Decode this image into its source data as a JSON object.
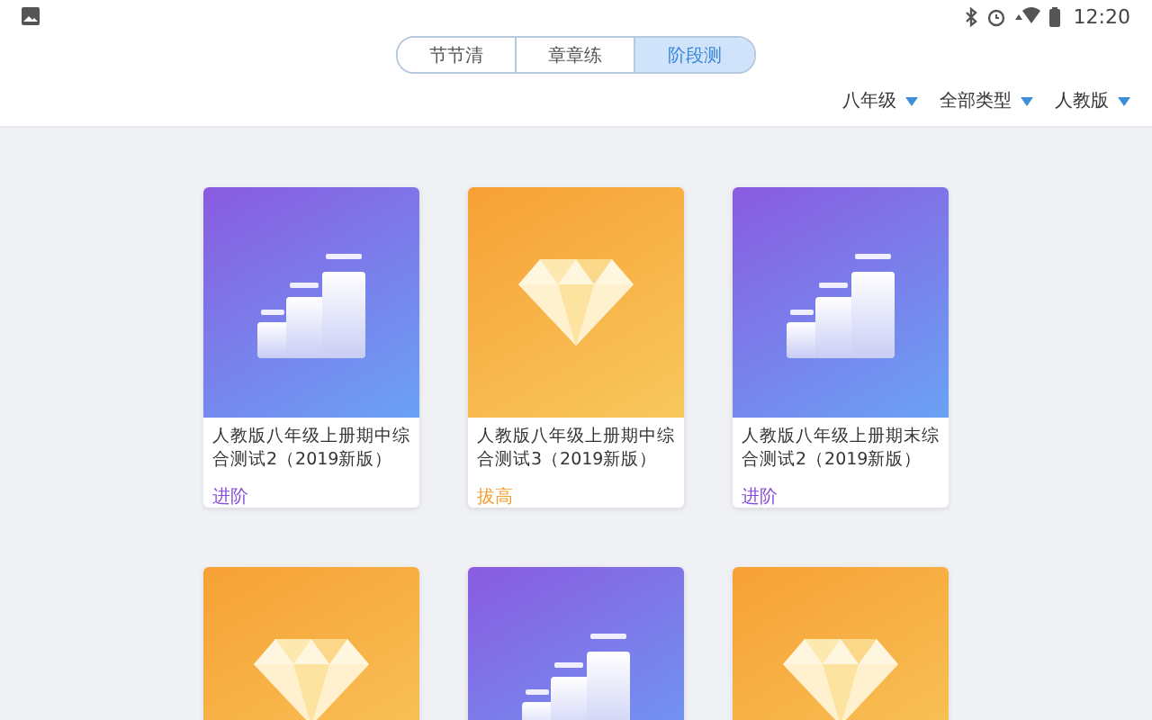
{
  "status_bar": {
    "time": "12:20"
  },
  "tabs": [
    {
      "label": "节节清",
      "selected": false
    },
    {
      "label": "章章练",
      "selected": false
    },
    {
      "label": "阶段测",
      "selected": true
    }
  ],
  "filters": [
    {
      "label": "八年级"
    },
    {
      "label": "全部类型"
    },
    {
      "label": "人教版"
    }
  ],
  "cards": [
    {
      "kind": "steps",
      "title": "人教版八年级上册期中综合测试2（2019新版）",
      "tag": "进阶"
    },
    {
      "kind": "diamond",
      "title": "人教版八年级上册期中综合测试3（2019新版）",
      "tag": "拔高"
    },
    {
      "kind": "steps",
      "title": "人教版八年级上册期末综合测试2（2019新版）",
      "tag": "进阶"
    },
    {
      "kind": "diamond"
    },
    {
      "kind": "steps"
    },
    {
      "kind": "diamond"
    }
  ]
}
